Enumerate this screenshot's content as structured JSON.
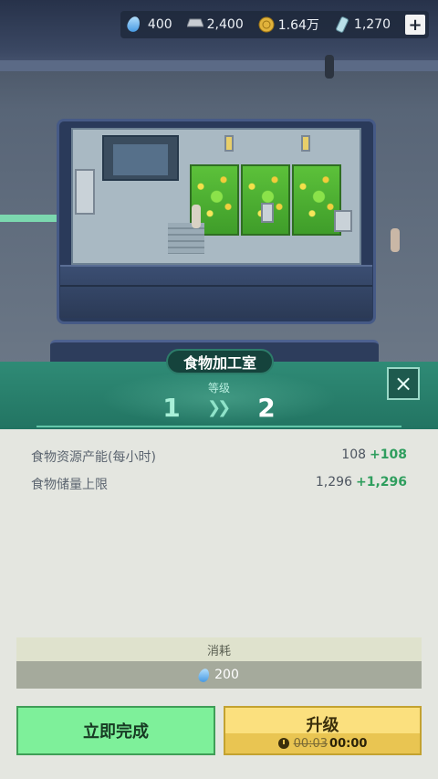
{
  "resources": [
    {
      "icon": "water-drop-icon",
      "value": "400"
    },
    {
      "icon": "metal-ingot-icon",
      "value": "2,400"
    },
    {
      "icon": "gold-coin-icon",
      "value": "1.64万"
    },
    {
      "icon": "energy-cell-icon",
      "value": "1,270"
    }
  ],
  "add_button_label": "+",
  "panel": {
    "title": "食物加工室",
    "grade_label": "等级",
    "level_from": "1",
    "level_arrow": "»",
    "level_to": "2",
    "close_icon": "×",
    "stats": [
      {
        "label": "食物资源产能(每小时)",
        "value": "108",
        "increase": "+108"
      },
      {
        "label": "食物储量上限",
        "value": "1,296",
        "increase": "+1,296"
      }
    ],
    "cost_label": "消耗",
    "cost_value": "200",
    "finish_button": "立即完成",
    "upgrade_button": "升级",
    "old_time": "00:03",
    "new_time": "00:00"
  },
  "colors": {
    "header": "#2f8b76",
    "finish_button": "#7ef09a",
    "upgrade_button": "#fbe07e",
    "increase_text": "#2f9e5e"
  }
}
